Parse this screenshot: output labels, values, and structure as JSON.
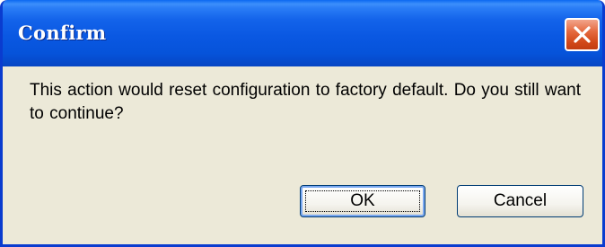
{
  "dialog": {
    "title": "Confirm",
    "message": "This action would reset configuration to factory default.  Do you still want to continue?",
    "buttons": {
      "ok_label": "OK",
      "cancel_label": "Cancel"
    },
    "close_icon": "close-icon"
  },
  "colors": {
    "title_bar": "#0653da",
    "window_border": "#0a3ccf",
    "dialog_background": "#ece9d8",
    "close_button": "#d2491a"
  }
}
